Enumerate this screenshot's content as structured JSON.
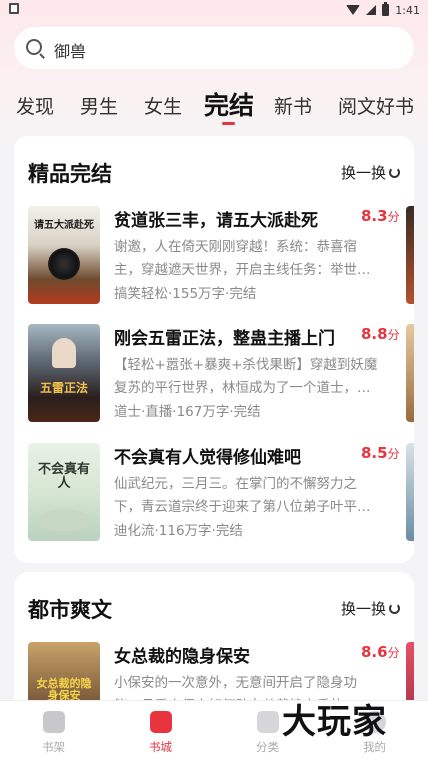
{
  "status": {
    "time": "1:41"
  },
  "search": {
    "placeholder": "御兽"
  },
  "tabs": [
    {
      "label": "发现"
    },
    {
      "label": "男生"
    },
    {
      "label": "女生"
    },
    {
      "label": "完结",
      "active": true
    },
    {
      "label": "新书"
    },
    {
      "label": "阅文好书"
    }
  ],
  "section1": {
    "title": "精品完结",
    "refresh": "换一换",
    "books": [
      {
        "title": "贫道张三丰，请五大派赴死",
        "score": "8.3",
        "score_unit": "分",
        "desc": "谢邀，人在倚天刚刚穿越！系统：恭喜宿主，穿越遮天世界，开启主线任务：举世…",
        "meta": "搞笑轻松·155万字·完结",
        "cover_text": "请五大派赴死"
      },
      {
        "title": "刚会五雷正法，整蛊主播上门",
        "score": "8.8",
        "score_unit": "分",
        "desc": "【轻松+嚣张+暴爽+杀伐果断】穿越到妖魔复苏的平行世界，林恒成为了一个道士，…",
        "meta": "道士·直播·167万字·完结",
        "cover_text": "五雷正法"
      },
      {
        "title": "不会真有人觉得修仙难吧",
        "score": "8.5",
        "score_unit": "分",
        "desc": "仙武纪元，三月三。在掌门的不懈努力之下，青云道宗终于迎来了第八位弟子叶平…",
        "meta": "迪化流·116万字·完结",
        "cover_text": "不会真有人"
      }
    ]
  },
  "section2": {
    "title": "都市爽文",
    "refresh": "换一换",
    "books": [
      {
        "title": "女总裁的隐身保安",
        "score": "8.6",
        "score_unit": "分",
        "desc": "小保安的一次意外，无意间开启了隐身功能，且看小保安如何助女总裁擦上手的…",
        "cover_text": "女总裁的隐身保安"
      }
    ]
  },
  "nav": [
    {
      "label": "书架"
    },
    {
      "label": "书城",
      "active": true
    },
    {
      "label": "分类"
    },
    {
      "label": "我的"
    }
  ],
  "watermark": "大玩家",
  "colors": {
    "accent": "#e8343f",
    "background": "#f4f4f6"
  }
}
